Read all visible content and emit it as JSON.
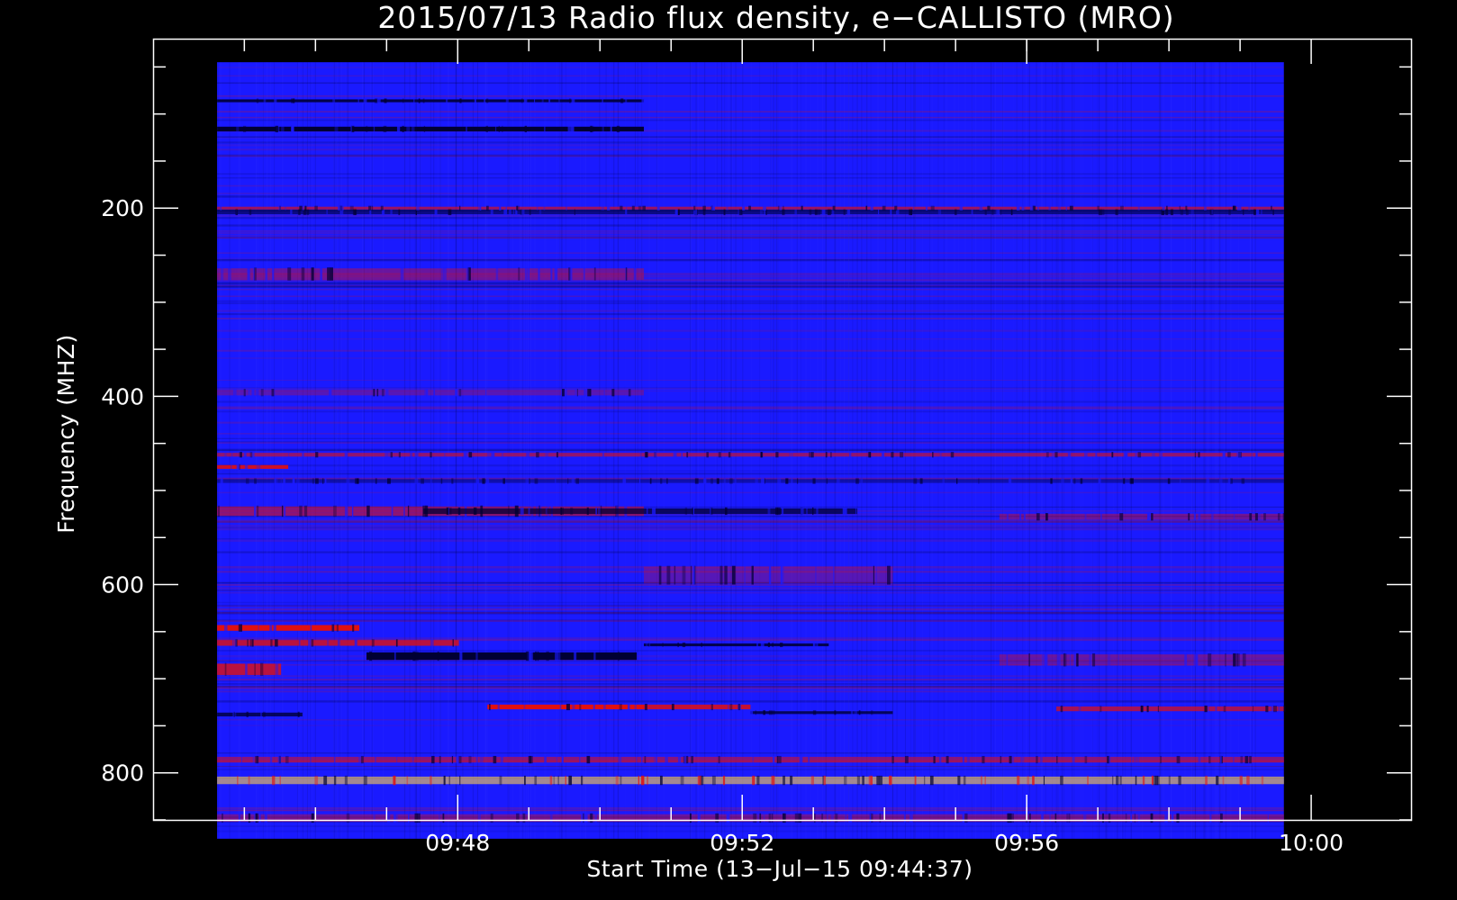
{
  "chart_data": {
    "type": "heatmap",
    "title": "2015/07/13  Radio flux density, e−CALLISTO (MRO)",
    "xlabel": "Start Time (13−Jul−15 09:44:37)",
    "ylabel": "Frequency (MHZ)",
    "x_tick_labels": [
      "09:48",
      "09:52",
      "09:56",
      "10:00"
    ],
    "x_tick_values_min": [
      3.383,
      7.383,
      11.383,
      15.383
    ],
    "y_tick_labels": [
      "200",
      "400",
      "600",
      "800"
    ],
    "y_tick_values": [
      200,
      400,
      600,
      800
    ],
    "xlim_min_after_start": [
      -0.9,
      16.8
    ],
    "ylim": [
      850,
      20
    ],
    "data_xrange_min_after_start": [
      0,
      15.0
    ],
    "data_yrange_mhz": [
      45,
      870
    ],
    "y_inverted": true,
    "colors": {
      "background": "#000000",
      "base": "#1a1aff",
      "dark": "#000033",
      "red": "#e01010",
      "yellow": "#ffd24a"
    },
    "features": [
      {
        "kind": "dark",
        "f": 86,
        "w": 3,
        "t0": 0,
        "t1": 6.0,
        "s": 0.9
      },
      {
        "kind": "dark",
        "f": 116,
        "w": 5,
        "t0": 0,
        "t1": 6.0,
        "s": 1.0
      },
      {
        "kind": "dark",
        "f": 204,
        "w": 5,
        "t0": 0,
        "t1": 15.0,
        "s": 0.6
      },
      {
        "kind": "red",
        "f": 200,
        "w": 3,
        "t0": 0,
        "t1": 15.0,
        "s": 0.6
      },
      {
        "kind": "red",
        "f": 270,
        "w": 12,
        "t0": 0,
        "t1": 6.0,
        "s": 0.4
      },
      {
        "kind": "red",
        "f": 396,
        "w": 6,
        "t0": 0,
        "t1": 6.0,
        "s": 0.3
      },
      {
        "kind": "red",
        "f": 462,
        "w": 4,
        "t0": 0,
        "t1": 15.0,
        "s": 0.6
      },
      {
        "kind": "red",
        "f": 475,
        "w": 4,
        "t0": 0,
        "t1": 1.0,
        "s": 0.9
      },
      {
        "kind": "dark",
        "f": 490,
        "w": 4,
        "t0": 0,
        "t1": 15.0,
        "s": 0.4
      },
      {
        "kind": "red",
        "f": 522,
        "w": 10,
        "t0": 0,
        "t1": 6.0,
        "s": 0.55
      },
      {
        "kind": "dark",
        "f": 522,
        "w": 6,
        "t0": 2.9,
        "t1": 9.0,
        "s": 0.75
      },
      {
        "kind": "red",
        "f": 528,
        "w": 6,
        "t0": 11.0,
        "t1": 15.0,
        "s": 0.4
      },
      {
        "kind": "red",
        "f": 590,
        "w": 18,
        "t0": 6.0,
        "t1": 9.5,
        "s": 0.3
      },
      {
        "kind": "red",
        "f": 646,
        "w": 6,
        "t0": 0,
        "t1": 2.0,
        "s": 1.0
      },
      {
        "kind": "red",
        "f": 662,
        "w": 6,
        "t0": 0,
        "t1": 3.4,
        "s": 0.8
      },
      {
        "kind": "dark",
        "f": 664,
        "w": 3,
        "t0": 6.0,
        "t1": 8.6,
        "s": 0.85
      },
      {
        "kind": "red",
        "f": 690,
        "w": 12,
        "t0": 0,
        "t1": 0.9,
        "s": 0.8
      },
      {
        "kind": "dark",
        "f": 676,
        "w": 8,
        "t0": 2.1,
        "t1": 5.9,
        "s": 1.0
      },
      {
        "kind": "red",
        "f": 680,
        "w": 12,
        "t0": 11.0,
        "t1": 15.0,
        "s": 0.35
      },
      {
        "kind": "red",
        "f": 730,
        "w": 5,
        "t0": 3.8,
        "t1": 6.0,
        "s": 1.0
      },
      {
        "kind": "red",
        "f": 730,
        "w": 5,
        "t0": 6.0,
        "t1": 7.5,
        "s": 0.85
      },
      {
        "kind": "red",
        "f": 732,
        "w": 5,
        "t0": 11.8,
        "t1": 15.0,
        "s": 0.7
      },
      {
        "kind": "dark",
        "f": 738,
        "w": 4,
        "t0": 0,
        "t1": 1.2,
        "s": 0.8
      },
      {
        "kind": "dark",
        "f": 736,
        "w": 3,
        "t0": 7.5,
        "t1": 9.5,
        "s": 0.8
      },
      {
        "kind": "red",
        "f": 786,
        "w": 6,
        "t0": 0,
        "t1": 15.0,
        "s": 0.55
      },
      {
        "kind": "yellow",
        "f": 808,
        "w": 8,
        "t0": 0,
        "t1": 15.0,
        "s": 0.6
      },
      {
        "kind": "red",
        "f": 848,
        "w": 8,
        "t0": 0,
        "t1": 15.0,
        "s": 0.4
      }
    ]
  }
}
